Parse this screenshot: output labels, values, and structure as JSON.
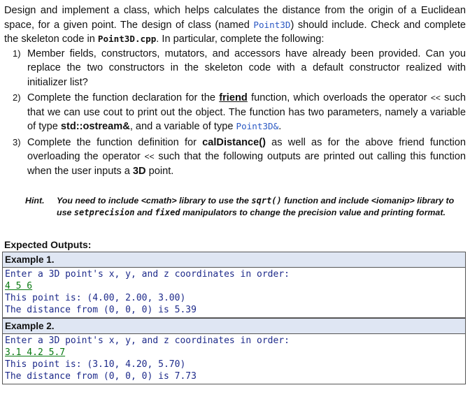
{
  "intro": {
    "t1": "Design and implement a class, which helps calculates the distance from the origin of a Euclidean space, for a given point. The design of class (named ",
    "class_name": "Point3D",
    "t2": ") should include. Check and complete the skeleton code in ",
    "file_name": "Point3D.cpp",
    "t3": ". In particular, complete the following:"
  },
  "items": [
    {
      "num": "1)",
      "text": "Member fields, constructors, mutators, and accessors have already been provided. Can you replace the two constructors in the skeleton code with a default constructor realized with initializer list?"
    },
    {
      "num": "2)",
      "t1": "Complete the function declaration for the ",
      "friend": "friend",
      "t2": " function, which overloads the operator ",
      "op": "<<",
      "t3": " such that we can use cout to print out the object. The function has two parameters, namely a variable of type ",
      "ostream": "std::ostream&",
      "t4": ", and a variable of type ",
      "ptype": "Point3D&",
      "t5": "."
    },
    {
      "num": "3)",
      "t1": "Complete the function definition for ",
      "fn": "calDistance()",
      "t2": " as well as for the above friend function overloading the operator ",
      "op": "<<",
      "t3": " such that the following outputs are printed out calling this function when the user inputs a ",
      "dim": "3D",
      "t4": " point."
    }
  ],
  "hint": {
    "label": "Hint.",
    "t1": "You need to include <cmath> library to use the ",
    "sqrt": "sqrt()",
    "t2": " function and include <iomanip> library to use ",
    "setp": "setprecision",
    "t3": " and ",
    "fixed": "fixed",
    "t4": " manipulators to change the precision value and printing format."
  },
  "outputs": {
    "title": "Expected Outputs:",
    "examples": [
      {
        "label": "Example 1.",
        "prompt": "Enter a 3D point's x, y, and z coordinates in order:",
        "input": "4 5 6",
        "line1": "This point is: (4.00, 2.00, 3.00)",
        "line2": "The distance from (0, 0, 0) is 5.39"
      },
      {
        "label": "Example 2.",
        "prompt": "Enter a 3D point's x, y, and z coordinates in order:",
        "input": "3.1 4.2 5.7",
        "line1": "This point is: (3.10, 4.20, 5.70)",
        "line2": "The distance from (0, 0, 0) is 7.73"
      }
    ]
  }
}
